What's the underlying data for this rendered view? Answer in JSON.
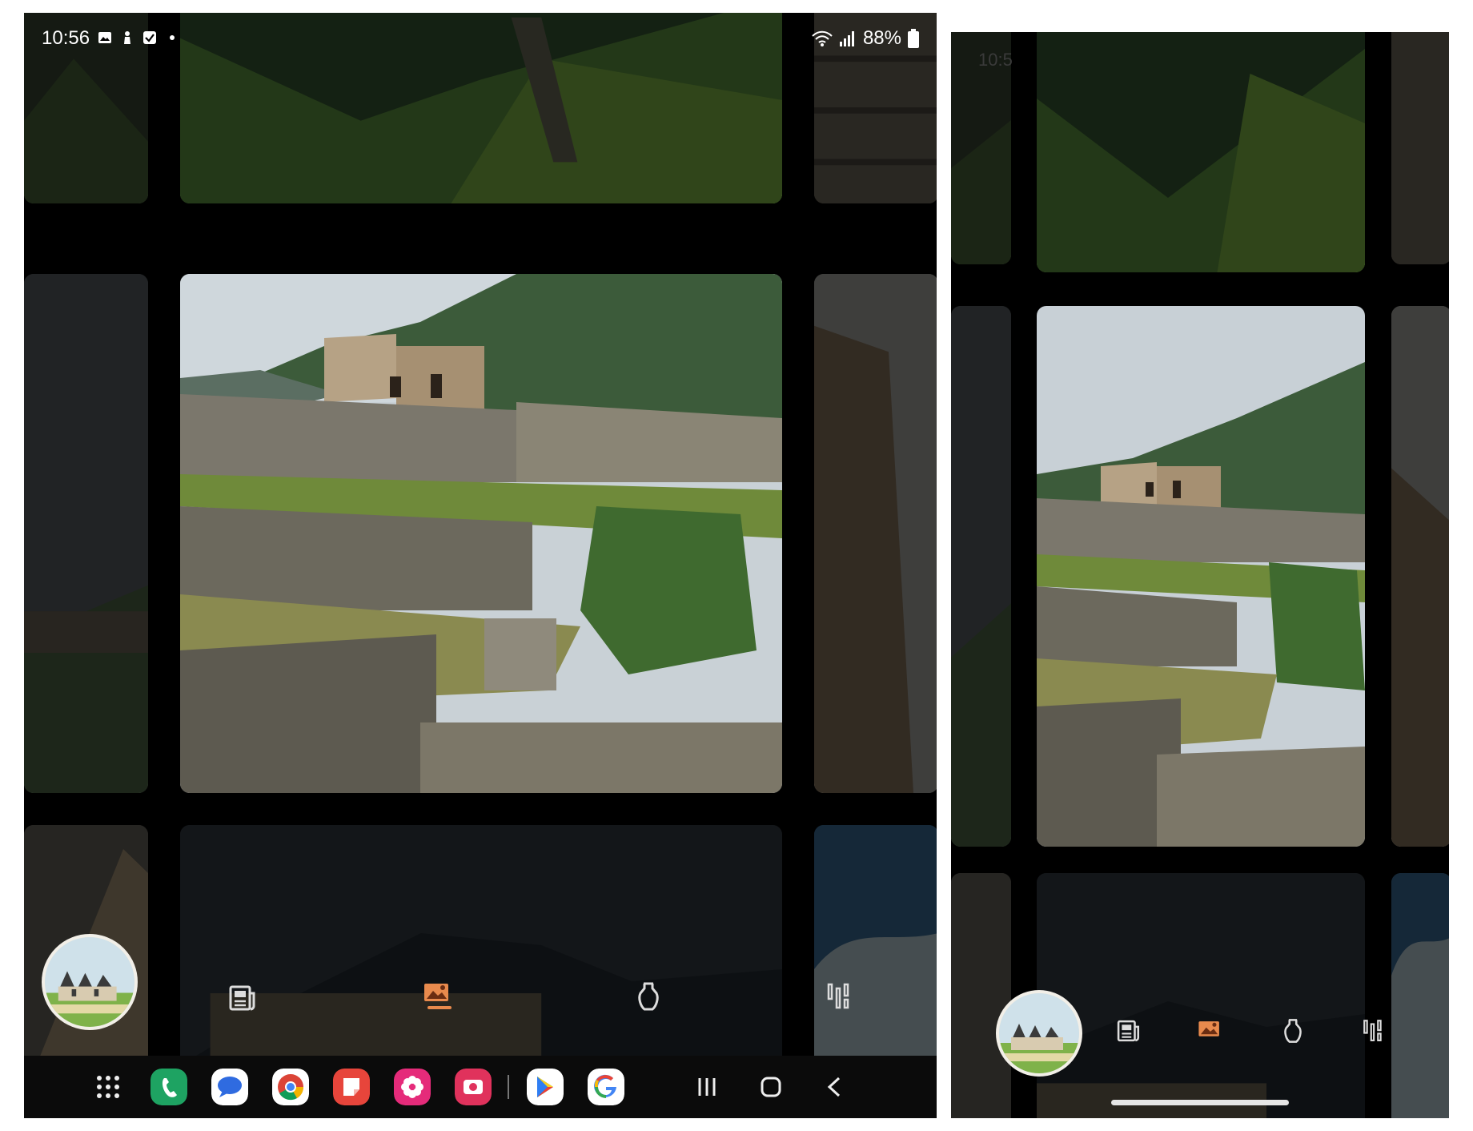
{
  "status": {
    "time": "10:56",
    "battery": "88%",
    "right_time_partial": "10:5"
  },
  "bottom_nav": {
    "items": [
      {
        "name": "news-icon"
      },
      {
        "name": "gallery-icon",
        "active": true
      },
      {
        "name": "artifact-icon"
      },
      {
        "name": "equalizer-icon"
      }
    ],
    "accent": "#e88a4d"
  },
  "taskbar": {
    "apps": [
      {
        "name": "app-drawer-icon"
      },
      {
        "name": "phone-app-icon",
        "color": "#1ea362"
      },
      {
        "name": "messages-app-icon",
        "color": "#ffffff"
      },
      {
        "name": "chrome-app-icon",
        "color": "#ffffff"
      },
      {
        "name": "notes-app-icon",
        "color": "#e7453b"
      },
      {
        "name": "flower-app-icon",
        "color": "#e52b7a"
      },
      {
        "name": "camera-app-icon",
        "color": "#e0325c"
      },
      {
        "name": "play-store-icon",
        "color": "#ffffff"
      },
      {
        "name": "google-app-icon",
        "color": "#ffffff"
      }
    ]
  }
}
